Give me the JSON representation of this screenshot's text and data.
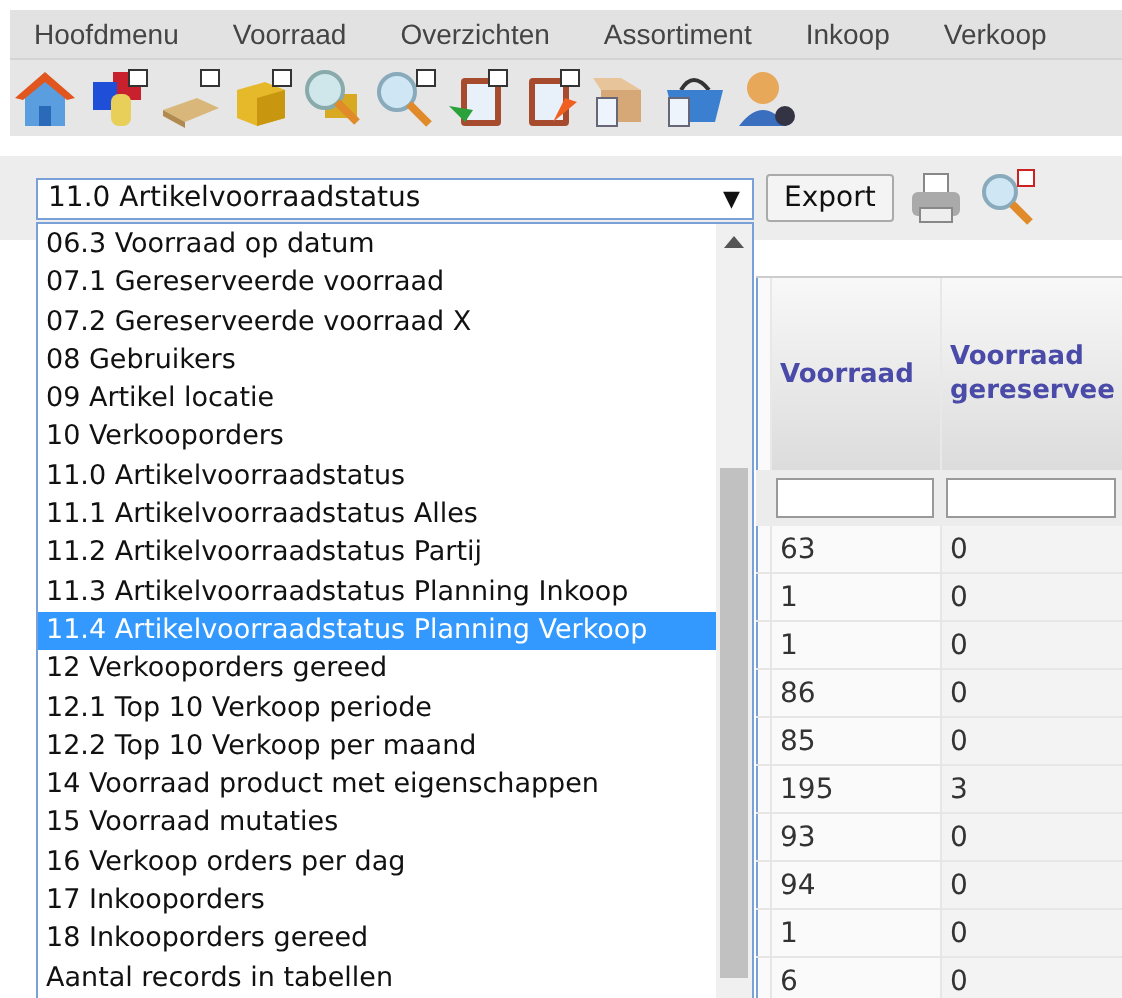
{
  "menu": [
    "Hoofdmenu",
    "Voorraad",
    "Overzichten",
    "Assortiment",
    "Inkoop",
    "Verkoop"
  ],
  "report_select": {
    "value": "11.0 Artikelvoorraadstatus",
    "arrow": "▼"
  },
  "export_button": "Export",
  "dropdown": {
    "options": [
      {
        "label": "06.3 Voorraad op datum",
        "selected": false
      },
      {
        "label": "07.1 Gereserveerde voorraad",
        "selected": false
      },
      {
        "label": "07.2 Gereserveerde voorraad X",
        "selected": false
      },
      {
        "label": "08 Gebruikers",
        "selected": false
      },
      {
        "label": "09 Artikel locatie",
        "selected": false
      },
      {
        "label": "10 Verkooporders",
        "selected": false
      },
      {
        "label": "11.0 Artikelvoorraadstatus",
        "selected": false
      },
      {
        "label": "11.1 Artikelvoorraadstatus Alles",
        "selected": false
      },
      {
        "label": "11.2 Artikelvoorraadstatus Partij",
        "selected": false
      },
      {
        "label": "11.3 Artikelvoorraadstatus Planning Inkoop",
        "selected": false
      },
      {
        "label": "11.4 Artikelvoorraadstatus Planning Verkoop",
        "selected": true
      },
      {
        "label": "12 Verkooporders gereed",
        "selected": false
      },
      {
        "label": "12.1 Top 10 Verkoop periode",
        "selected": false
      },
      {
        "label": "12.2 Top 10 Verkoop per maand",
        "selected": false
      },
      {
        "label": "14 Voorraad product met eigenschappen",
        "selected": false
      },
      {
        "label": "15 Voorraad mutaties",
        "selected": false
      },
      {
        "label": "16 Verkoop orders per dag",
        "selected": false
      },
      {
        "label": "17 Inkooporders",
        "selected": false
      },
      {
        "label": "18 Inkooporders gereed",
        "selected": false
      },
      {
        "label": "Aantal records in tabellen",
        "selected": false
      }
    ]
  },
  "table": {
    "columns": [
      "Voorraad",
      "Voorraad gereservee"
    ],
    "rows": [
      [
        "63",
        "0"
      ],
      [
        "1",
        "0"
      ],
      [
        "1",
        "0"
      ],
      [
        "86",
        "0"
      ],
      [
        "85",
        "0"
      ],
      [
        "195",
        "3"
      ],
      [
        "93",
        "0"
      ],
      [
        "94",
        "0"
      ],
      [
        "1",
        "0"
      ],
      [
        "6",
        "0"
      ]
    ]
  }
}
